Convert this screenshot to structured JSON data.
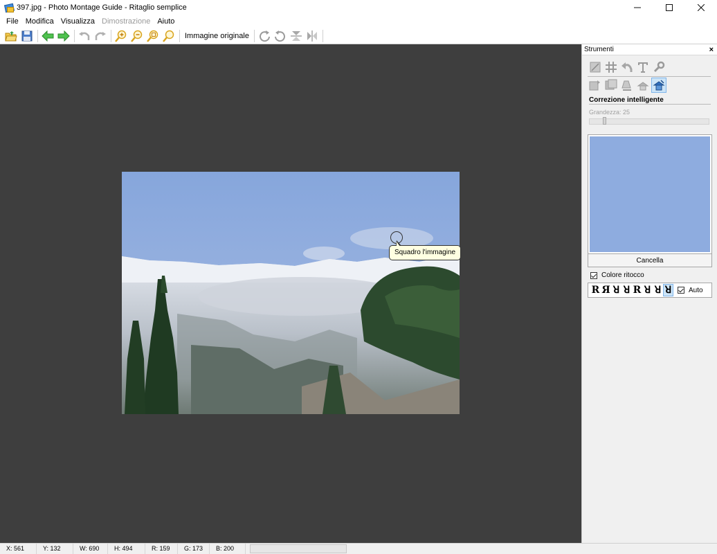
{
  "window": {
    "title": "397.jpg - Photo Montage Guide - Ritaglio semplice",
    "minimize": "—",
    "maximize": "☐",
    "close": "✕"
  },
  "menu": {
    "items": [
      {
        "label": "File",
        "enabled": true
      },
      {
        "label": "Modifica",
        "enabled": true
      },
      {
        "label": "Visualizza",
        "enabled": true
      },
      {
        "label": "Dimostrazione",
        "enabled": false
      },
      {
        "label": "Aiuto",
        "enabled": true
      }
    ]
  },
  "toolbar": {
    "original_image_label": "Immagine originale"
  },
  "canvas": {
    "tooltip": "Squadro l'immagine"
  },
  "panel": {
    "title": "Strumenti",
    "close": "×",
    "section_title": "Correzione intelligente",
    "size_label": "Grandezza: 25",
    "size_value": 25,
    "cancel_label": "Cancella",
    "retouch_color_label": "Colore ritocco",
    "retouch_color_checked": true,
    "auto_label": "Auto",
    "auto_checked": true,
    "preview_color": "#8eacdf",
    "orientations": [
      "R",
      "Я",
      "ꓤ",
      "ꓤ",
      "R",
      "ꓤ",
      "ꓤ",
      "ꓤ"
    ],
    "selected_orientation": 7
  },
  "status": {
    "x": "X: 561",
    "y": "Y: 132",
    "w": "W: 690",
    "h": "H: 494",
    "r": "R: 159",
    "g": "G: 173",
    "b": "B: 200"
  },
  "colors": {
    "canvas_bg": "#3e3e3e",
    "sky": "#8eacdf",
    "selection": "#cce4f7"
  },
  "icons": {
    "toolbar": [
      "open-folder-icon",
      "save-icon",
      "back-arrow-icon",
      "forward-arrow-icon",
      "undo-icon",
      "redo-icon",
      "zoom-in-icon",
      "zoom-out-icon",
      "zoom-fit-icon",
      "zoom-actual-icon",
      "rotate-right-icon",
      "rotate-left-icon",
      "flip-vertical-icon",
      "flip-horizontal-icon"
    ],
    "tools_row1": [
      "crop-icon",
      "grid-icon",
      "undo-tool-icon",
      "text-icon",
      "wrench-icon"
    ],
    "tools_row2": [
      "clone-icon",
      "layers-icon",
      "eraser-icon",
      "hat-icon",
      "smart-fix-icon"
    ]
  }
}
